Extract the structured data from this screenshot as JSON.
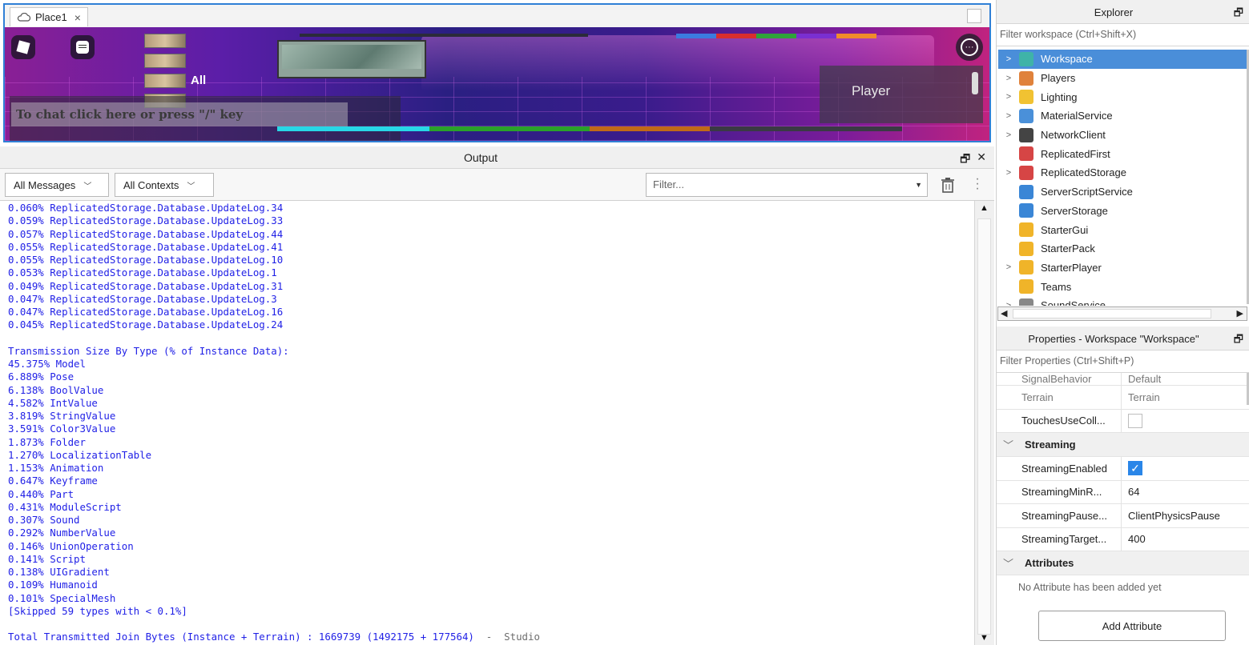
{
  "document_tab": {
    "title": "Place1",
    "close": "×"
  },
  "game": {
    "chat_tab": "All",
    "chat_placeholder": "To chat click here or press \"/\" key",
    "player_panel_label": "Player",
    "menu_icon": "more-icon"
  },
  "output": {
    "title": "Output",
    "float_icon": "🗗",
    "close_icon": "✕",
    "messages_filter": "All Messages",
    "contexts_filter": "All Contexts",
    "filter_placeholder": "Filter...",
    "lines": [
      "0.060% ReplicatedStorage.Database.UpdateLog.34",
      "0.059% ReplicatedStorage.Database.UpdateLog.33",
      "0.057% ReplicatedStorage.Database.UpdateLog.44",
      "0.055% ReplicatedStorage.Database.UpdateLog.41",
      "0.055% ReplicatedStorage.Database.UpdateLog.10",
      "0.053% ReplicatedStorage.Database.UpdateLog.1",
      "0.049% ReplicatedStorage.Database.UpdateLog.31",
      "0.047% ReplicatedStorage.Database.UpdateLog.3",
      "0.047% ReplicatedStorage.Database.UpdateLog.16",
      "0.045% ReplicatedStorage.Database.UpdateLog.24",
      "",
      "Transmission Size By Type (% of Instance Data):",
      "45.375% Model",
      "6.889% Pose",
      "6.138% BoolValue",
      "4.582% IntValue",
      "3.819% StringValue",
      "3.591% Color3Value",
      "1.873% Folder",
      "1.270% LocalizationTable",
      "1.153% Animation",
      "0.647% Keyframe",
      "0.440% Part",
      "0.431% ModuleScript",
      "0.307% Sound",
      "0.292% NumberValue",
      "0.146% UnionOperation",
      "0.141% Script",
      "0.138% UIGradient",
      "0.109% Humanoid",
      "0.101% SpecialMesh",
      "[Skipped 59 types with < 0.1%]",
      ""
    ],
    "total_line": "Total Transmitted Join Bytes (Instance + Terrain) : 1669739 (1492175 + 177564)",
    "total_source": "  -  Studio"
  },
  "explorer": {
    "title": "Explorer",
    "float_icon": "🗗",
    "filter_placeholder": "Filter workspace (Ctrl+Shift+X)",
    "items": [
      {
        "label": "Workspace",
        "expandable": true,
        "selected": true,
        "icon": "workspace-icon",
        "color": "#3fb3a8"
      },
      {
        "label": "Players",
        "expandable": true,
        "selected": false,
        "icon": "players-icon",
        "color": "#e0823b"
      },
      {
        "label": "Lighting",
        "expandable": true,
        "selected": false,
        "icon": "lighting-icon",
        "color": "#f1c232"
      },
      {
        "label": "MaterialService",
        "expandable": true,
        "selected": false,
        "icon": "material-service-icon",
        "color": "#4a90d9"
      },
      {
        "label": "NetworkClient",
        "expandable": true,
        "selected": false,
        "icon": "network-client-icon",
        "color": "#444444"
      },
      {
        "label": "ReplicatedFirst",
        "expandable": false,
        "selected": false,
        "icon": "replicated-first-icon",
        "color": "#d64545"
      },
      {
        "label": "ReplicatedStorage",
        "expandable": true,
        "selected": false,
        "icon": "replicated-storage-icon",
        "color": "#d64545"
      },
      {
        "label": "ServerScriptService",
        "expandable": false,
        "selected": false,
        "icon": "server-script-service-icon",
        "color": "#3a86d6"
      },
      {
        "label": "ServerStorage",
        "expandable": false,
        "selected": false,
        "icon": "server-storage-icon",
        "color": "#3a86d6"
      },
      {
        "label": "StarterGui",
        "expandable": false,
        "selected": false,
        "icon": "starter-gui-icon",
        "color": "#f0b429"
      },
      {
        "label": "StarterPack",
        "expandable": false,
        "selected": false,
        "icon": "starter-pack-icon",
        "color": "#f0b429"
      },
      {
        "label": "StarterPlayer",
        "expandable": true,
        "selected": false,
        "icon": "starter-player-icon",
        "color": "#f0b429"
      },
      {
        "label": "Teams",
        "expandable": false,
        "selected": false,
        "icon": "teams-icon",
        "color": "#f0b429"
      },
      {
        "label": "SoundService",
        "expandable": true,
        "selected": false,
        "icon": "sound-service-icon",
        "color": "#888888"
      }
    ]
  },
  "properties": {
    "title": "Properties - Workspace \"Workspace\"",
    "float_icon": "🗗",
    "filter_placeholder": "Filter Properties (Ctrl+Shift+P)",
    "rows_top": [
      {
        "name": "SignalBehavior",
        "value": "Default",
        "dim": true,
        "partial": true
      },
      {
        "name": "Terrain",
        "value": "Terrain",
        "dim": true
      },
      {
        "name": "TouchesUseColl...",
        "value": "",
        "checkbox": false
      }
    ],
    "streaming_section": "Streaming",
    "streaming_rows": [
      {
        "name": "StreamingEnabled",
        "checkbox": true
      },
      {
        "name": "StreamingMinR...",
        "value": "64"
      },
      {
        "name": "StreamingPause...",
        "value": "ClientPhysicsPause"
      },
      {
        "name": "StreamingTarget...",
        "value": "400"
      }
    ],
    "attributes_section": "Attributes",
    "no_attributes": "No Attribute has been added yet",
    "add_attribute": "Add Attribute"
  }
}
